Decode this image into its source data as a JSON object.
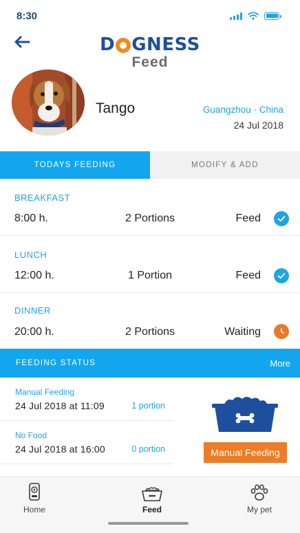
{
  "status_bar": {
    "time": "8:30"
  },
  "header": {
    "brand": "DOGNESS",
    "title": "Feed"
  },
  "pet": {
    "name": "Tango",
    "location": "Guangzhou · China",
    "date": "24 Jul 2018"
  },
  "tabs": [
    {
      "label": "TODAYS FEEDING",
      "active": true
    },
    {
      "label": "MODIFY & ADD",
      "active": false
    }
  ],
  "meals": [
    {
      "name": "BREAKFAST",
      "time": "8:00 h.",
      "portions": "2 Portions",
      "status": "Feed",
      "icon": "check-circle-icon"
    },
    {
      "name": "LUNCH",
      "time": "12:00 h.",
      "portions": "1 Portion",
      "status": "Feed",
      "icon": "check-circle-icon"
    },
    {
      "name": "DINNER",
      "time": "20:00 h.",
      "portions": "2 Portions",
      "status": "Waiting",
      "icon": "clock-icon"
    }
  ],
  "feeding_status": {
    "title": "FEEDING STATUS",
    "more": "More",
    "entries": [
      {
        "label": "Manual Feeding",
        "datetime": "24 Jul 2018 at 11:09",
        "portion": "1 portion"
      },
      {
        "label": "No Food",
        "datetime": "24 Jul 2018 at 16:00",
        "portion": "0 portion"
      }
    ],
    "manual_button": "Manual Feeding"
  },
  "nav": [
    {
      "label": "Home",
      "icon": "camera-device-icon",
      "active": false
    },
    {
      "label": "Feed",
      "icon": "food-bowl-icon",
      "active": true
    },
    {
      "label": "My pet",
      "icon": "paw-icon",
      "active": false
    }
  ],
  "colors": {
    "accent": "#13a6ee",
    "orange": "#ec7c26",
    "brand_blue": "#1d4f9e"
  }
}
